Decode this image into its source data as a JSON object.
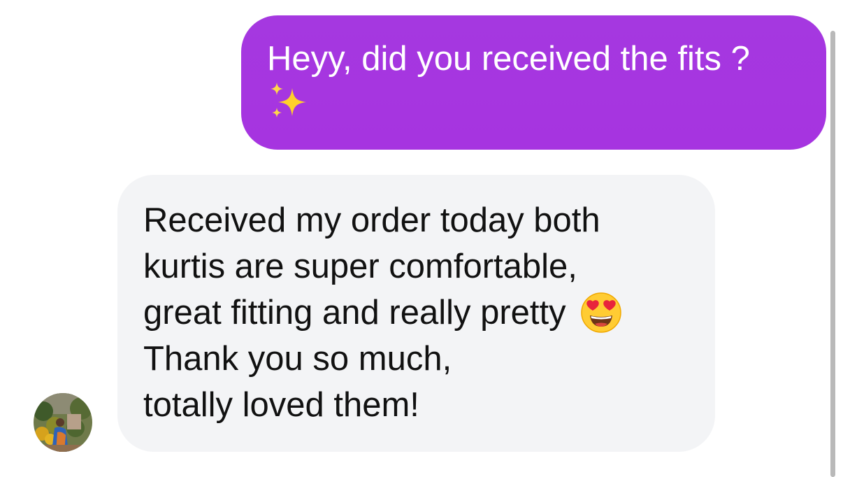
{
  "messages": [
    {
      "direction": "outgoing",
      "text": "Heyy, did you received the fits ?",
      "trailing_emoji": "sparkles-emoji",
      "bubble_color": "#a535df"
    },
    {
      "direction": "incoming",
      "lines": [
        "Received my order today both",
        "kurtis are super comfortable,",
        "great fitting and really pretty",
        "Thank you so much,",
        "totally loved them!"
      ],
      "inline_emoji": "heart-eyes-emoji",
      "bubble_color": "#f3f4f6",
      "sender_avatar": "avatar-photo"
    }
  ]
}
